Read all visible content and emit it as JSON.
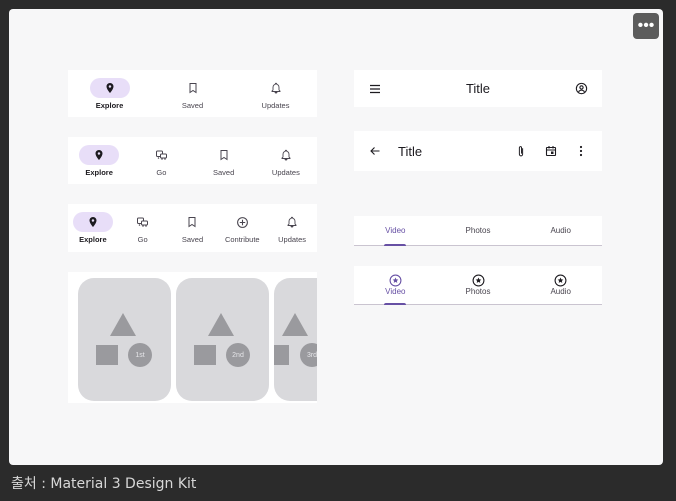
{
  "toolbar": {
    "more_label": "•••"
  },
  "caption": "출처 : Material 3 Design Kit",
  "nav_bars": [
    {
      "items": [
        {
          "label": "Explore",
          "icon": "location-pin-icon",
          "active": true
        },
        {
          "label": "Saved",
          "icon": "bookmark-icon"
        },
        {
          "label": "Updates",
          "icon": "bell-icon"
        }
      ]
    },
    {
      "items": [
        {
          "label": "Explore",
          "icon": "location-pin-icon",
          "active": true
        },
        {
          "label": "Go",
          "icon": "commute-icon"
        },
        {
          "label": "Saved",
          "icon": "bookmark-icon"
        },
        {
          "label": "Updates",
          "icon": "bell-icon"
        }
      ]
    },
    {
      "items": [
        {
          "label": "Explore",
          "icon": "location-pin-icon",
          "active": true
        },
        {
          "label": "Go",
          "icon": "commute-icon"
        },
        {
          "label": "Saved",
          "icon": "bookmark-icon"
        },
        {
          "label": "Contribute",
          "icon": "add-circle-icon"
        },
        {
          "label": "Updates",
          "icon": "bell-icon"
        }
      ]
    }
  ],
  "carousel": {
    "items": [
      "1st",
      "2nd",
      "3rd"
    ]
  },
  "top_app_bar_center": {
    "title": "Title",
    "leading_icon": "menu-icon",
    "trailing_icon": "account-circle-icon"
  },
  "top_app_bar_small": {
    "title": "Title",
    "leading_icon": "back-arrow-icon",
    "actions": [
      "attach-icon",
      "calendar-icon",
      "more-vert-icon"
    ]
  },
  "tabs_text": {
    "items": [
      {
        "label": "Video",
        "active": true
      },
      {
        "label": "Photos"
      },
      {
        "label": "Audio"
      }
    ]
  },
  "tabs_icon": {
    "items": [
      {
        "label": "Video",
        "active": true,
        "icon": "star-circle-icon"
      },
      {
        "label": "Photos",
        "icon": "star-circle-icon"
      },
      {
        "label": "Audio",
        "icon": "star-circle-icon"
      }
    ]
  },
  "colors": {
    "accent": "#6750a4",
    "active_pill": "#e8def8",
    "placeholder": "#d9d9dc"
  }
}
